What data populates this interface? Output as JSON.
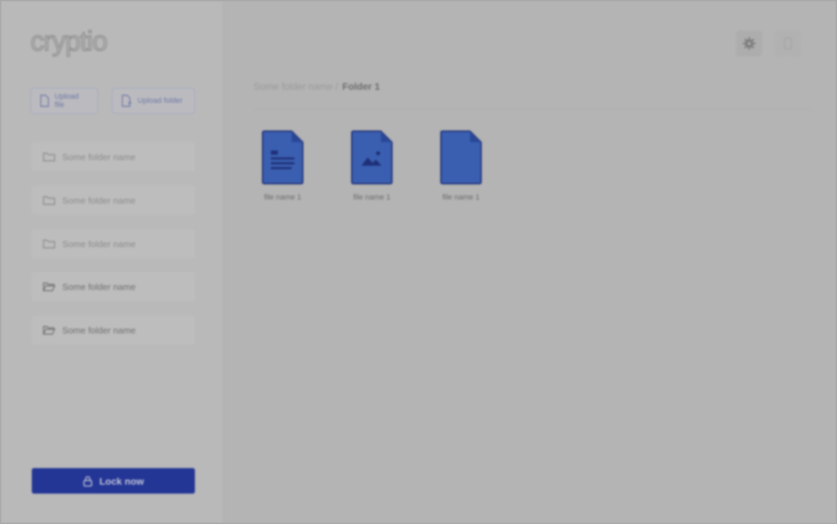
{
  "app": {
    "logo_text": "cryptio"
  },
  "sidebar": {
    "upload_file_label": "Upload file",
    "upload_folder_label": "Upload folder",
    "folders": [
      {
        "label": "Some folder name",
        "icon": "folder-closed-icon"
      },
      {
        "label": "Some folder name",
        "icon": "folder-closed-icon"
      },
      {
        "label": "Some folder name",
        "icon": "folder-closed-icon"
      },
      {
        "label": "Some folder name",
        "icon": "folder-open-icon"
      },
      {
        "label": "Some folder name",
        "icon": "folder-open-icon"
      }
    ],
    "lock_label": "Lock now"
  },
  "header": {
    "settings_icon": "gear-icon",
    "user_icon": "user-icon"
  },
  "breadcrumb": {
    "parent": "Some folder name /",
    "current": "Folder 1"
  },
  "files": [
    {
      "name": "file name 1",
      "type": "document"
    },
    {
      "name": "file name 1",
      "type": "image"
    },
    {
      "name": "file name 1",
      "type": "blank"
    }
  ],
  "colors": {
    "accent": "#233595",
    "file_blue": "#3a5fb0",
    "overlay": "#b4b4b4"
  }
}
